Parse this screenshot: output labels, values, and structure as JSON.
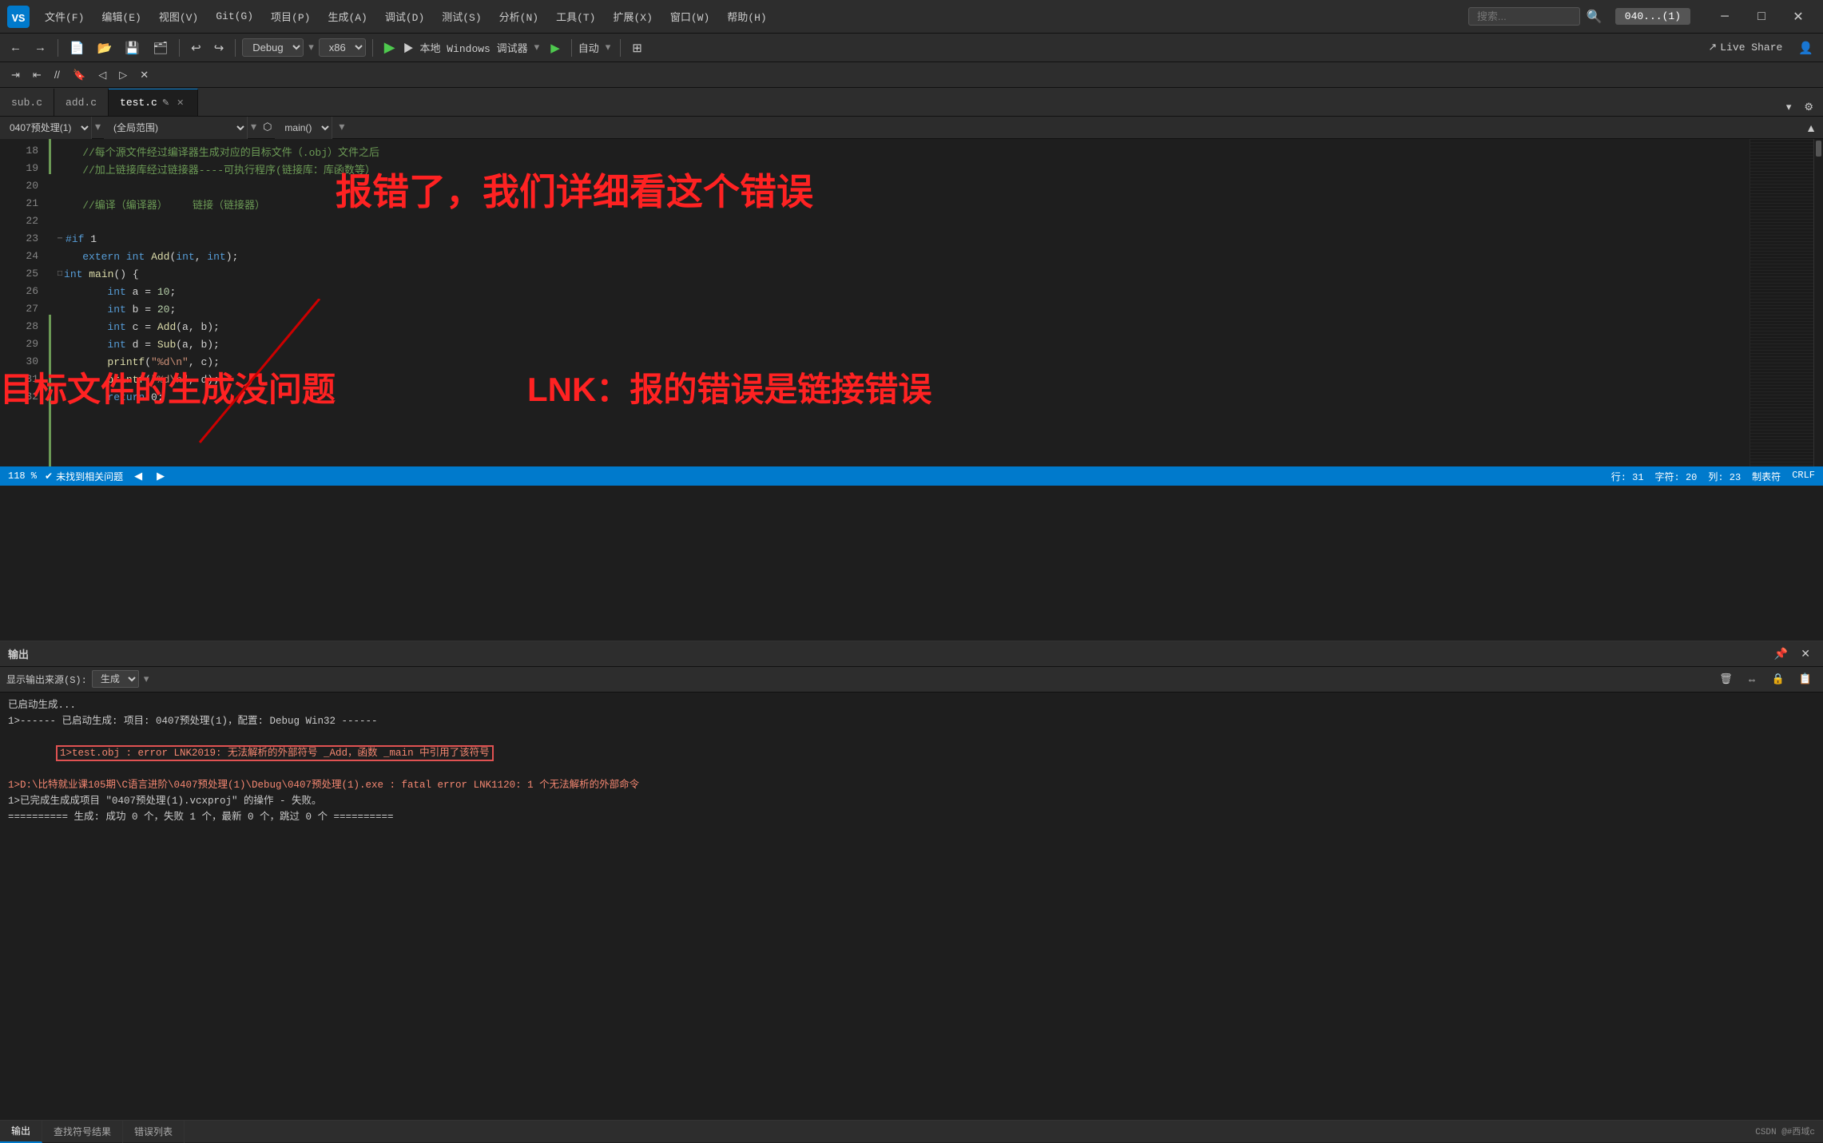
{
  "app": {
    "title": "040...(1)"
  },
  "menu": {
    "logo_symbol": "✦",
    "items": [
      {
        "label": "文件(F)"
      },
      {
        "label": "编辑(E)"
      },
      {
        "label": "视图(V)"
      },
      {
        "label": "Git(G)"
      },
      {
        "label": "项目(P)"
      },
      {
        "label": "生成(A)"
      },
      {
        "label": "调试(D)"
      },
      {
        "label": "测试(S)"
      },
      {
        "label": "分析(N)"
      },
      {
        "label": "工具(T)"
      },
      {
        "label": "扩展(X)"
      },
      {
        "label": "窗口(W)"
      },
      {
        "label": "帮助(H)"
      }
    ],
    "search_placeholder": "搜索...",
    "live_share": "Live Share",
    "window_min": "─",
    "window_max": "□",
    "window_close": "✕"
  },
  "toolbar": {
    "back": "←",
    "forward": "→",
    "config": "⚙",
    "debug_mode": "Debug",
    "arch": "x86",
    "run_label": "▶ 本地 Windows 调试器",
    "auto_label": "自动",
    "layout_btn": "⊞"
  },
  "tabs": {
    "items": [
      {
        "label": "sub.c",
        "active": false
      },
      {
        "label": "add.c",
        "active": false
      },
      {
        "label": "test.c",
        "active": true,
        "modified": true
      }
    ]
  },
  "editor_nav": {
    "scope": "0407预处理(1)",
    "context": "(全局范围)",
    "func": "main()"
  },
  "code": {
    "lines": [
      {
        "num": 18,
        "content": "    //每个源文件经过编译器生成对应的目标文件（.obj）文件之后",
        "indent": 0,
        "marker": true
      },
      {
        "num": 19,
        "content": "    //加上链接库经过链接器----可执行程序(链接库：库函数等）",
        "indent": 0,
        "marker": true
      },
      {
        "num": 20,
        "content": "",
        "indent": 0
      },
      {
        "num": 21,
        "content": "    //编译（编译器）    链接（链接器）",
        "indent": 0
      },
      {
        "num": 22,
        "content": "",
        "indent": 0
      },
      {
        "num": 23,
        "content": "#if 1",
        "indent": 0
      },
      {
        "num": 24,
        "content": "    extern int Add(int, int);",
        "indent": 0
      },
      {
        "num": 25,
        "content": "    int main() {",
        "indent": 0
      },
      {
        "num": 26,
        "content": "        int a = 10;",
        "indent": 1
      },
      {
        "num": 27,
        "content": "        int b = 20;",
        "indent": 1
      },
      {
        "num": 28,
        "content": "        int c = Add(a, b);",
        "indent": 1
      },
      {
        "num": 29,
        "content": "        int d = Sub(a, b);",
        "indent": 1
      },
      {
        "num": 30,
        "content": "        printf(\"%d\\n\", c);",
        "indent": 1
      },
      {
        "num": 31,
        "content": "        printf(\"%d\\n\", d);",
        "indent": 1
      },
      {
        "num": 32,
        "content": "        return 0;",
        "indent": 1
      }
    ]
  },
  "status_bar": {
    "zoom": "118 %",
    "check_label": "未找到相关问题",
    "line": "行: 31",
    "char": "字符: 20",
    "col": "列: 23",
    "tab_label": "制表符",
    "encoding": "CRLF"
  },
  "output_panel": {
    "title": "输出",
    "source_label": "显示输出来源(S):",
    "source_value": "生成",
    "content_lines": [
      {
        "text": "已启动生成...",
        "type": "normal"
      },
      {
        "text": "1>------ 已启动生成: 项目: 0407预处理(1)，配置: Debug Win32 ------",
        "type": "normal"
      },
      {
        "text": "1>test.obj : error LNK2019: 无法解析的外部符号 _Add，函数 _main 中引用了该符号",
        "type": "error",
        "box_start": "test.obj",
        "box_end": "该符号"
      },
      {
        "text": "1>D:\\比特就业课105期\\C语言进阶\\0407预处理(1)\\Debug\\0407预处理(1).exe : fatal error LNK1120: 1 个无法解析的外部命令",
        "type": "error"
      },
      {
        "text": "1>已完成生成成项目 \"0407预处理(1).vcxproj\" 的操作 - 失败。",
        "type": "normal"
      },
      {
        "text": "========== 生成: 成功 0 个，失败 1 个，最新 0 个，跳过 0 个 ==========",
        "type": "normal"
      }
    ]
  },
  "output_tabs": [
    {
      "label": "输出",
      "active": true
    },
    {
      "label": "查找符号结果",
      "active": false
    },
    {
      "label": "错误列表",
      "active": false
    }
  ],
  "annotations": {
    "title": "报错了，我们详细看这个错误",
    "note1": "目标文件的生成没问题",
    "note2": "LNK：报的错误是链接错误"
  },
  "watermark": "CSDN @#西域c"
}
